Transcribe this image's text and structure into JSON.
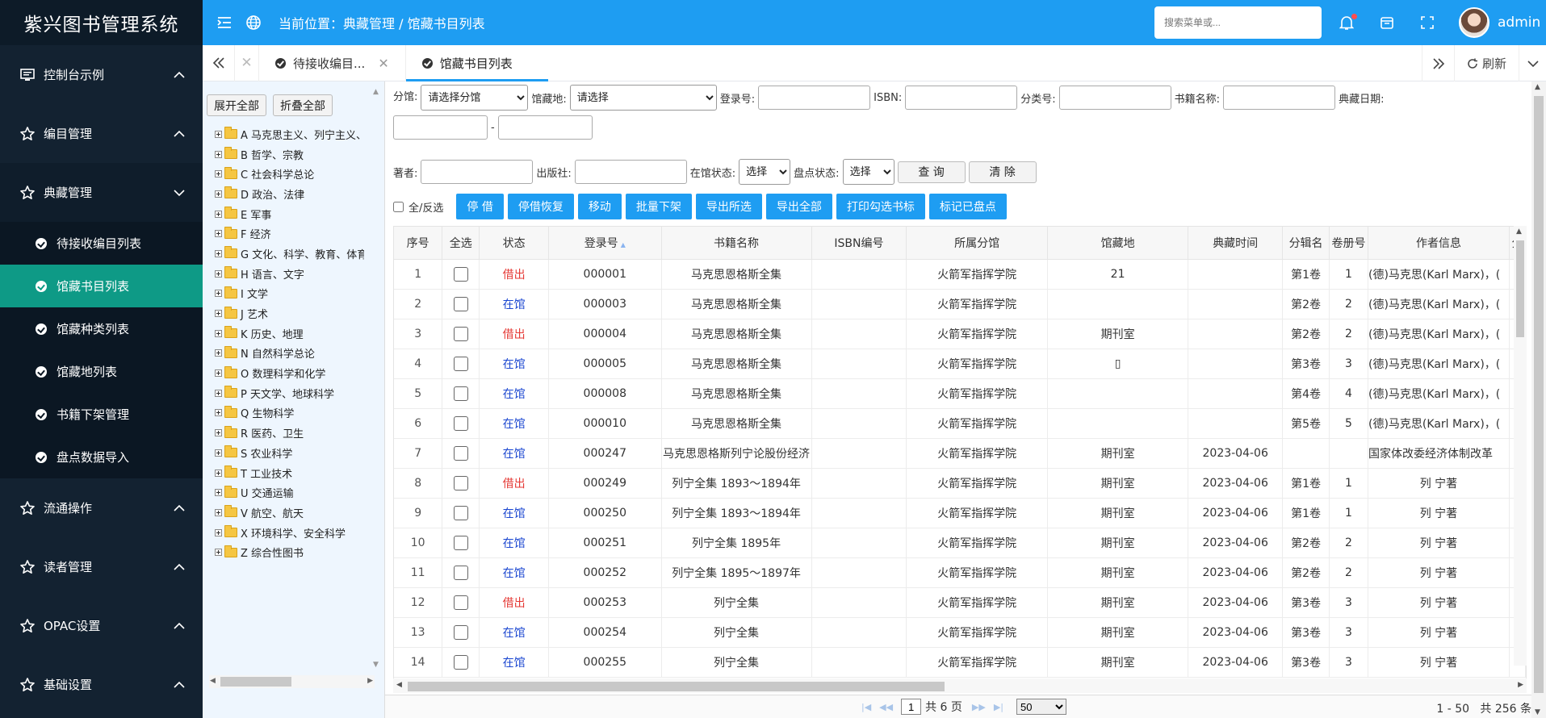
{
  "sidebar": {
    "brand": "紫兴图书管理系统",
    "menus": [
      {
        "label": "控制台示例"
      },
      {
        "label": "编目管理"
      },
      {
        "label": "典藏管理"
      }
    ],
    "submenu": [
      {
        "label": "待接收编目列表"
      },
      {
        "label": "馆藏书目列表"
      },
      {
        "label": "馆藏种类列表"
      },
      {
        "label": "馆藏地列表"
      },
      {
        "label": "书籍下架管理"
      },
      {
        "label": "盘点数据导入"
      }
    ],
    "menus_after": [
      {
        "label": "流通操作"
      },
      {
        "label": "读者管理"
      },
      {
        "label": "OPAC设置"
      },
      {
        "label": "基础设置"
      }
    ]
  },
  "header": {
    "crumb": "当前位置：典藏管理 / 馆藏书目列表",
    "search_placeholder": "搜索菜单或...",
    "user": "admin",
    "accent": "#1e9df2"
  },
  "tabs": {
    "items": [
      {
        "label": "待接收编目..."
      },
      {
        "label": "馆藏书目列表"
      }
    ],
    "refresh": "刷新"
  },
  "tree": {
    "expand_all": "展开全部",
    "collapse_all": "折叠全部",
    "nodes": [
      "A 马克思主义、列宁主义、",
      "B 哲学、宗教",
      "C 社会科学总论",
      "D 政治、法律",
      "E 军事",
      "F 经济",
      "G 文化、科学、教育、体育",
      "H 语言、文字",
      "I 文学",
      "J 艺术",
      "K 历史、地理",
      "N 自然科学总论",
      "O 数理科学和化学",
      "P 天文学、地球科学",
      "Q 生物科学",
      "R 医药、卫生",
      "S 农业科学",
      "T 工业技术",
      "U 交通运输",
      "V 航空、航天",
      "X 环境科学、安全科学",
      "Z 综合性图书"
    ]
  },
  "filters": {
    "branch_label": "分馆:",
    "branch_value": "请选择分馆",
    "location_label": "馆藏地:",
    "location_value": "请选择",
    "reg_label": "登录号:",
    "isbn_label": "ISBN:",
    "class_label": "分类号:",
    "title_label": "书籍名称:",
    "date_label": "典藏日期:",
    "date_sep": "-",
    "author_label": "著者:",
    "publisher_label": "出版社:",
    "instock_label": "在馆状态:",
    "instock_value": "选择",
    "inventory_label": "盘点状态:",
    "inventory_value": "选择",
    "query": "查 询",
    "clear": "清 除",
    "select_all": "全/反选"
  },
  "actions": [
    "停 借",
    "停借恢复",
    "移动",
    "批量下架",
    "导出所选",
    "导出全部",
    "打印勾选书标",
    "标记已盘点"
  ],
  "table": {
    "headers": [
      "序号",
      "全选",
      "状态",
      "登录号",
      "书籍名称",
      "ISBN编号",
      "所属分馆",
      "馆藏地",
      "典藏时间",
      "分辑名",
      "卷册号",
      "作者信息",
      "分"
    ],
    "rows": [
      [
        "1",
        "借出",
        "000001",
        "马克思恩格斯全集",
        "",
        "火箭军指挥学院",
        "21",
        "",
        "第1卷",
        "1",
        "(德)马克思(Karl Marx)，("
      ],
      [
        "2",
        "在馆",
        "000003",
        "马克思恩格斯全集",
        "",
        "火箭军指挥学院",
        "",
        "",
        "第2卷",
        "2",
        "(德)马克思(Karl Marx)，("
      ],
      [
        "3",
        "借出",
        "000004",
        "马克思恩格斯全集",
        "",
        "火箭军指挥学院",
        "期刊室",
        "",
        "第2卷",
        "2",
        "(德)马克思(Karl Marx)，("
      ],
      [
        "4",
        "在馆",
        "000005",
        "马克思恩格斯全集",
        "",
        "火箭军指挥学院",
        "▯",
        "",
        "第3卷",
        "3",
        "(德)马克思(Karl Marx)，("
      ],
      [
        "5",
        "在馆",
        "000008",
        "马克思恩格斯全集",
        "",
        "火箭军指挥学院",
        "",
        "",
        "第4卷",
        "4",
        "(德)马克思(Karl Marx)，("
      ],
      [
        "6",
        "在馆",
        "000010",
        "马克思恩格斯全集",
        "",
        "火箭军指挥学院",
        "",
        "",
        "第5卷",
        "5",
        "(德)马克思(Karl Marx)，("
      ],
      [
        "7",
        "在馆",
        "000247",
        "马克思恩格斯列宁论股份经济",
        "",
        "火箭军指挥学院",
        "期刊室",
        "2023-04-06",
        "",
        "",
        "国家体改委经济体制改革"
      ],
      [
        "8",
        "借出",
        "000249",
        "列宁全集 1893～1894年",
        "",
        "火箭军指挥学院",
        "期刊室",
        "2023-04-06",
        "第1卷",
        "1",
        "列 宁著"
      ],
      [
        "9",
        "在馆",
        "000250",
        "列宁全集 1893～1894年",
        "",
        "火箭军指挥学院",
        "期刊室",
        "2023-04-06",
        "第1卷",
        "1",
        "列 宁著"
      ],
      [
        "10",
        "在馆",
        "000251",
        "列宁全集 1895年",
        "",
        "火箭军指挥学院",
        "期刊室",
        "2023-04-06",
        "第2卷",
        "2",
        "列 宁著"
      ],
      [
        "11",
        "在馆",
        "000252",
        "列宁全集 1895～1897年",
        "",
        "火箭军指挥学院",
        "期刊室",
        "2023-04-06",
        "第2卷",
        "2",
        "列 宁著"
      ],
      [
        "12",
        "借出",
        "000253",
        "列宁全集",
        "",
        "火箭军指挥学院",
        "期刊室",
        "2023-04-06",
        "第3卷",
        "3",
        "列 宁著"
      ],
      [
        "13",
        "在馆",
        "000254",
        "列宁全集",
        "",
        "火箭军指挥学院",
        "期刊室",
        "2023-04-06",
        "第3卷",
        "3",
        "列 宁著"
      ],
      [
        "14",
        "在馆",
        "000255",
        "列宁全集",
        "",
        "火箭军指挥学院",
        "期刊室",
        "2023-04-06",
        "第3卷",
        "3",
        "列 宁著"
      ]
    ]
  },
  "pager": {
    "page": "1",
    "total_pages": "共 6 页",
    "page_size": "50",
    "info": "1 - 50   共 256 条"
  }
}
